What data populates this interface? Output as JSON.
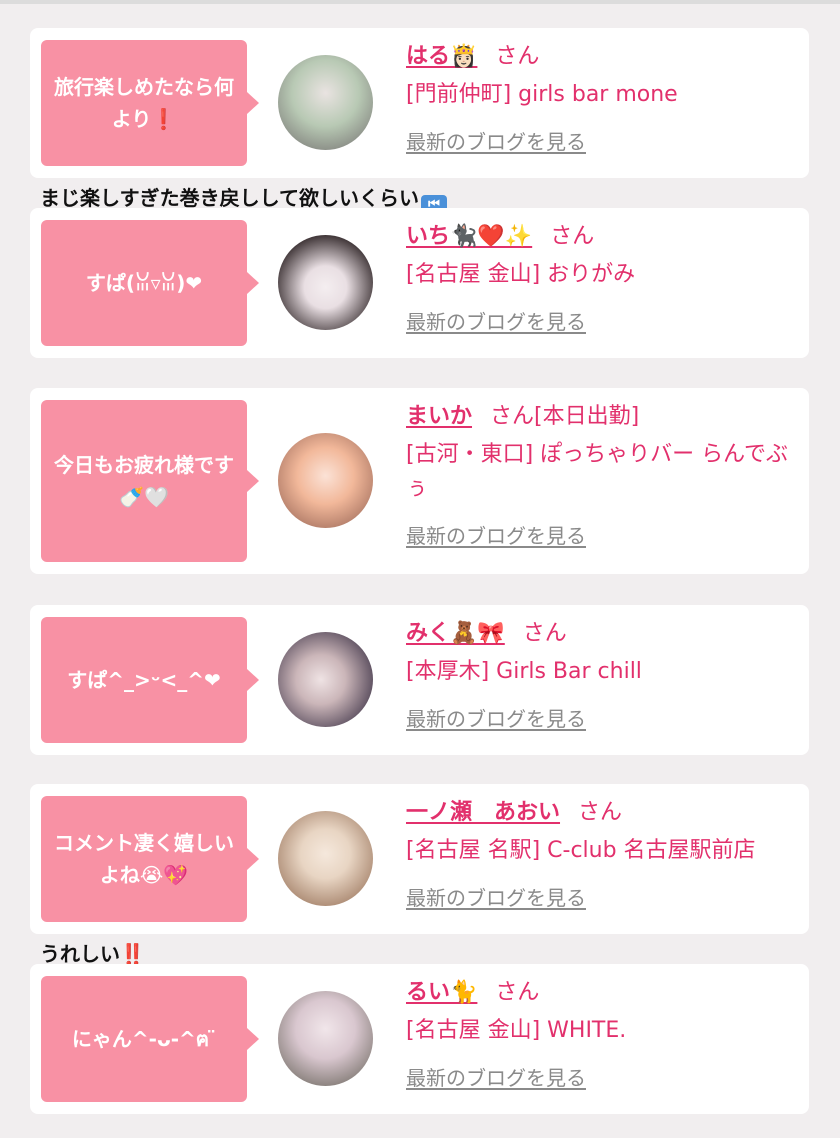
{
  "entries": [
    {
      "bubble": "旅行楽しめたなら何より❗",
      "name": "はる👸🏻",
      "san": "さん",
      "shop": "[門前仲町] girls bar mone",
      "blog_link": "最新のブログを見る",
      "avatar_colors": [
        "#b8c9b4",
        "#6f6a6b"
      ]
    },
    {
      "bubble": "すぱ(ꈍ▿ꈍ)❤",
      "name": "いち🐈‍⬛❤️✨",
      "san": "さん",
      "shop": "[名古屋 金山] おりがみ",
      "blog_link": "最新のブログを見る",
      "avatar_colors": [
        "#3b3133",
        "#e9dfe3"
      ]
    },
    {
      "bubble": "今日もお疲れ様です🍼🤍",
      "name": "まいか",
      "san": "さん[本日出勤]",
      "shop": "[古河・東口] ぽっちゃりバー らんでぶぅ",
      "blog_link": "最新のブログを見る",
      "avatar_colors": [
        "#f2b89a",
        "#8c5a4c"
      ]
    },
    {
      "bubble": "すぱ^_>ᵕ<_^❤",
      "name": "みく🧸🎀",
      "san": "さん",
      "shop": "[本厚木] Girls Bar chill",
      "blog_link": "最新のブログを見る",
      "avatar_colors": [
        "#453a4d",
        "#cbb6b9"
      ]
    },
    {
      "bubble": "コメント凄く嬉しいよね😭💖",
      "name": "一ノ瀬　あおい",
      "san": "さん",
      "shop": "[名古屋 名駅] C-club 名古屋駅前店",
      "blog_link": "最新のブログを見る",
      "avatar_colors": [
        "#e8d5c3",
        "#8a6147"
      ]
    },
    {
      "bubble": "にゃん^-ᴗ-^ฅ ̈",
      "name": "るい🐈",
      "san": "さん",
      "shop": "[名古屋 金山] WHITE.",
      "blog_link": "最新のブログを見る",
      "avatar_colors": [
        "#d9c7cf",
        "#5d5a4f"
      ]
    }
  ],
  "comments": {
    "c1": "まじ楽しすぎた巻き戻しして欲しいくらい",
    "c1_icon": "rewind-icon",
    "c2": "うれしい‼️"
  },
  "colors": {
    "accent": "#e2306c",
    "bubble": "#f891a4",
    "background": "#f1eeef",
    "card": "#ffffff",
    "link_gray": "#8a8a8a"
  }
}
